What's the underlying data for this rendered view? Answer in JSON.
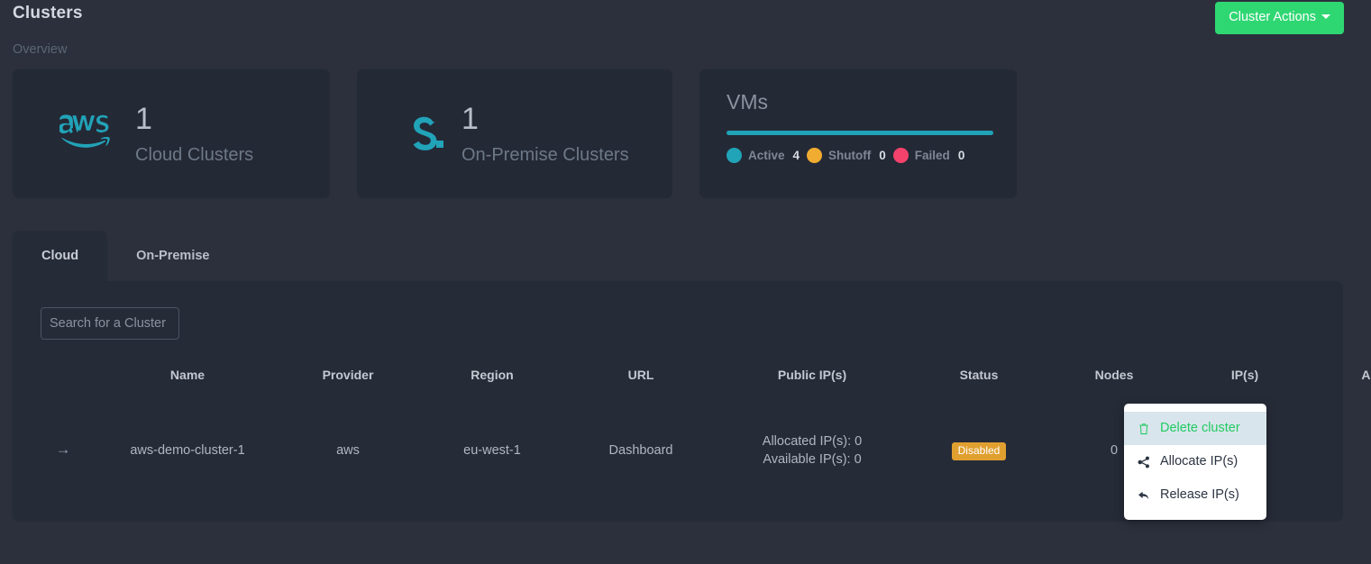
{
  "header": {
    "title": "Clusters",
    "subtitle": "Overview",
    "cluster_actions_label": "Cluster Actions"
  },
  "cards": {
    "cloud": {
      "icon": "aws-logo-icon",
      "count": "1",
      "label": "Cloud Clusters"
    },
    "onpremise": {
      "icon": "sunstone-s-logo-icon",
      "count": "1",
      "label": "On-Premise Clusters"
    },
    "vms": {
      "title": "VMs",
      "bar_color": "#21a3b8",
      "legend": [
        {
          "name": "Active",
          "value": "4",
          "color": "#21a3b8"
        },
        {
          "name": "Shutoff",
          "value": "0",
          "color": "#f0ac30"
        },
        {
          "name": "Failed",
          "value": "0",
          "color": "#f5426c"
        }
      ]
    }
  },
  "tabs": [
    {
      "label": "Cloud",
      "active": true
    },
    {
      "label": "On-Premise",
      "active": false
    }
  ],
  "search": {
    "placeholder": "Search for a Cluster",
    "value": ""
  },
  "table": {
    "columns": [
      "",
      "Name",
      "Provider",
      "Region",
      "URL",
      "Public IP(s)",
      "Status",
      "Nodes",
      "IP(s)",
      "Actions"
    ],
    "rows": [
      {
        "arrow_icon": "arrow-right-icon",
        "name": "aws-demo-cluster-1",
        "provider": "aws",
        "region": "eu-west-1",
        "url": "Dashboard",
        "public_ips_allocated": "Allocated IP(s): 0",
        "public_ips_available": "Available IP(s): 0",
        "status": "Disabled",
        "status_color": "#e0a030",
        "nodes": "0",
        "ips": "",
        "actions_icon": "gear-icon"
      }
    ]
  },
  "dropdown": {
    "items": [
      {
        "label": "Delete cluster",
        "icon": "trash-icon",
        "highlight": true
      },
      {
        "label": "Allocate IP(s)",
        "icon": "share-icon",
        "highlight": false
      },
      {
        "label": "Release IP(s)",
        "icon": "reply-icon",
        "highlight": false
      }
    ]
  },
  "colors": {
    "page_bg": "#2b303c",
    "card_bg": "#242936",
    "panel_bg": "#262b38",
    "accent_green": "#2fd773",
    "accent_teal": "#21a3b8",
    "menu_green": "#23cb63"
  }
}
